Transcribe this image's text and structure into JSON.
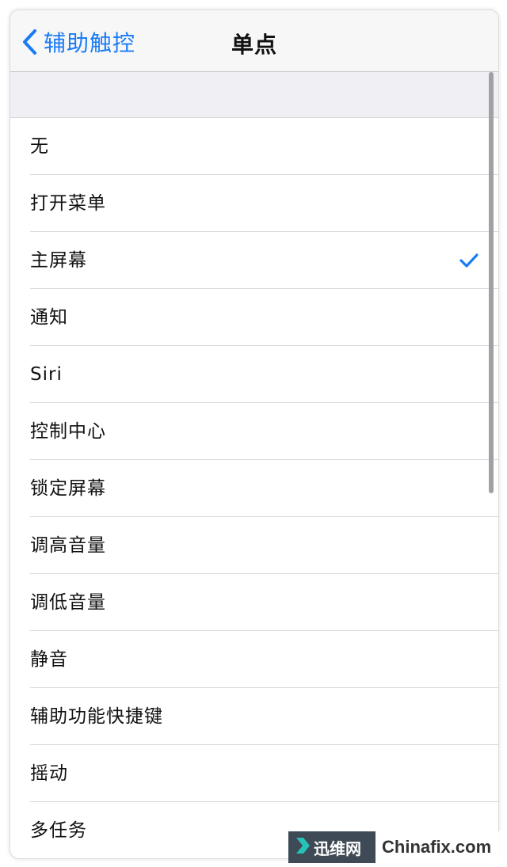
{
  "nav": {
    "back_label": "辅助触控",
    "title": "单点"
  },
  "options": [
    {
      "label": "无",
      "selected": false
    },
    {
      "label": "打开菜单",
      "selected": false
    },
    {
      "label": "主屏幕",
      "selected": true
    },
    {
      "label": "通知",
      "selected": false
    },
    {
      "label": "Siri",
      "selected": false
    },
    {
      "label": "控制中心",
      "selected": false
    },
    {
      "label": "锁定屏幕",
      "selected": false
    },
    {
      "label": "调高音量",
      "selected": false
    },
    {
      "label": "调低音量",
      "selected": false
    },
    {
      "label": "静音",
      "selected": false
    },
    {
      "label": "辅助功能快捷键",
      "selected": false
    },
    {
      "label": "摇动",
      "selected": false
    },
    {
      "label": "多任务",
      "selected": false
    }
  ],
  "watermark": {
    "left_text": "迅维网",
    "right_text": "Chinafix.com"
  },
  "colors": {
    "accent": "#1a7cf5",
    "nav_bg": "#f7f7f8",
    "group_bg": "#efeff4",
    "separator": "#d9d9dc"
  },
  "icons": {
    "back": "chevron-left-icon",
    "selected": "checkmark-icon",
    "watermark_logo": "arrow-logo-icon"
  }
}
